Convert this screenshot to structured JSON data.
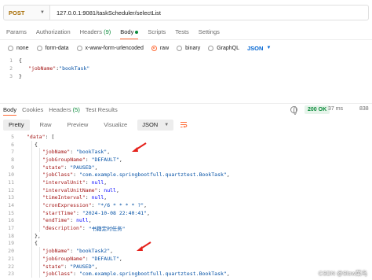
{
  "request": {
    "method": "POST",
    "url": "127.0.0.1:9081/taskScheduler/selectList"
  },
  "request_tabs": [
    {
      "label": "Params"
    },
    {
      "label": "Authorization"
    },
    {
      "label": "Headers",
      "count": "(9)"
    },
    {
      "label": "Body"
    },
    {
      "label": "Scripts"
    },
    {
      "label": "Tests"
    },
    {
      "label": "Settings"
    }
  ],
  "body_options": {
    "none": "none",
    "form_data": "form-data",
    "urlencoded": "x-www-form-urlencoded",
    "raw": "raw",
    "binary": "binary",
    "graphql": "GraphQL",
    "format": "JSON"
  },
  "request_body": {
    "lines": [
      {
        "n": "1",
        "text": "{"
      },
      {
        "n": "2",
        "key": "\"jobName\"",
        "value": "\"bookTask\""
      },
      {
        "n": "3",
        "text": "}"
      }
    ]
  },
  "response_tabs": [
    {
      "label": "Body"
    },
    {
      "label": "Cookies"
    },
    {
      "label": "Headers",
      "count": "(5)"
    },
    {
      "label": "Test Results"
    }
  ],
  "response_meta": {
    "status": "200 OK",
    "time": "37 ms",
    "size": "838"
  },
  "response_toolbar": {
    "pretty": "Pretty",
    "raw": "Raw",
    "preview": "Preview",
    "visualize": "Visualize",
    "format": "JSON"
  },
  "response_body": {
    "lines": [
      {
        "n": "5",
        "indent": 1,
        "key": "\"data\"",
        "value": "[",
        "vtype": "punc"
      },
      {
        "n": "6",
        "indent": 2,
        "text": "{"
      },
      {
        "n": "7",
        "indent": 3,
        "key": "\"jobName\"",
        "value": "\"bookTask\"",
        "vtype": "str",
        "comma": true
      },
      {
        "n": "8",
        "indent": 3,
        "key": "\"jobGroupName\"",
        "value": "\"DEFAULT\"",
        "vtype": "str",
        "comma": true
      },
      {
        "n": "9",
        "indent": 3,
        "key": "\"state\"",
        "value": "\"PAUSED\"",
        "vtype": "str",
        "comma": true
      },
      {
        "n": "10",
        "indent": 3,
        "key": "\"jobClass\"",
        "value": "\"com.example.springbootfull.quartztest.BookTask\"",
        "vtype": "str",
        "comma": true
      },
      {
        "n": "11",
        "indent": 3,
        "key": "\"intervalUnit\"",
        "value": "null",
        "vtype": "kw",
        "comma": true
      },
      {
        "n": "12",
        "indent": 3,
        "key": "\"intervalUnitName\"",
        "value": "null",
        "vtype": "kw",
        "comma": true
      },
      {
        "n": "13",
        "indent": 3,
        "key": "\"timeInterval\"",
        "value": "null",
        "vtype": "kw",
        "comma": true
      },
      {
        "n": "14",
        "indent": 3,
        "key": "\"cronExpression\"",
        "value": "\"*/6 * * * * ?\"",
        "vtype": "str",
        "comma": true
      },
      {
        "n": "15",
        "indent": 3,
        "key": "\"startTime\"",
        "value": "\"2024-10-08 22:40:41\"",
        "vtype": "str",
        "comma": true
      },
      {
        "n": "16",
        "indent": 3,
        "key": "\"endTime\"",
        "value": "null",
        "vtype": "kw",
        "comma": true
      },
      {
        "n": "17",
        "indent": 3,
        "key": "\"description\"",
        "value": "\"书籍定时任务\"",
        "vtype": "str",
        "comma": false
      },
      {
        "n": "18",
        "indent": 2,
        "text": "},"
      },
      {
        "n": "19",
        "indent": 2,
        "text": "{"
      },
      {
        "n": "20",
        "indent": 3,
        "key": "\"jobName\"",
        "value": "\"bookTask2\"",
        "vtype": "str",
        "comma": true
      },
      {
        "n": "21",
        "indent": 3,
        "key": "\"jobGroupName\"",
        "value": "\"DEFAULT\"",
        "vtype": "str",
        "comma": true
      },
      {
        "n": "22",
        "indent": 3,
        "key": "\"state\"",
        "value": "\"PAUSED\"",
        "vtype": "str",
        "comma": true
      },
      {
        "n": "23",
        "indent": 3,
        "key": "\"jobClass\"",
        "value": "\"com.example.springbootfull.quartztest.BookTask\"",
        "vtype": "str",
        "comma": true
      }
    ]
  },
  "watermark": "CSDN @Slow菜鸟",
  "colors": {
    "accent": "#ff6c37",
    "status_ok": "#0a8a3a",
    "json_key": "#a31515",
    "json_string": "#0451a5",
    "annotation_arrow": "#e5221c"
  },
  "icons": [
    "chevron-down-icon",
    "globe-icon",
    "wrap-lines-icon",
    "arrow-annotation-icon"
  ]
}
